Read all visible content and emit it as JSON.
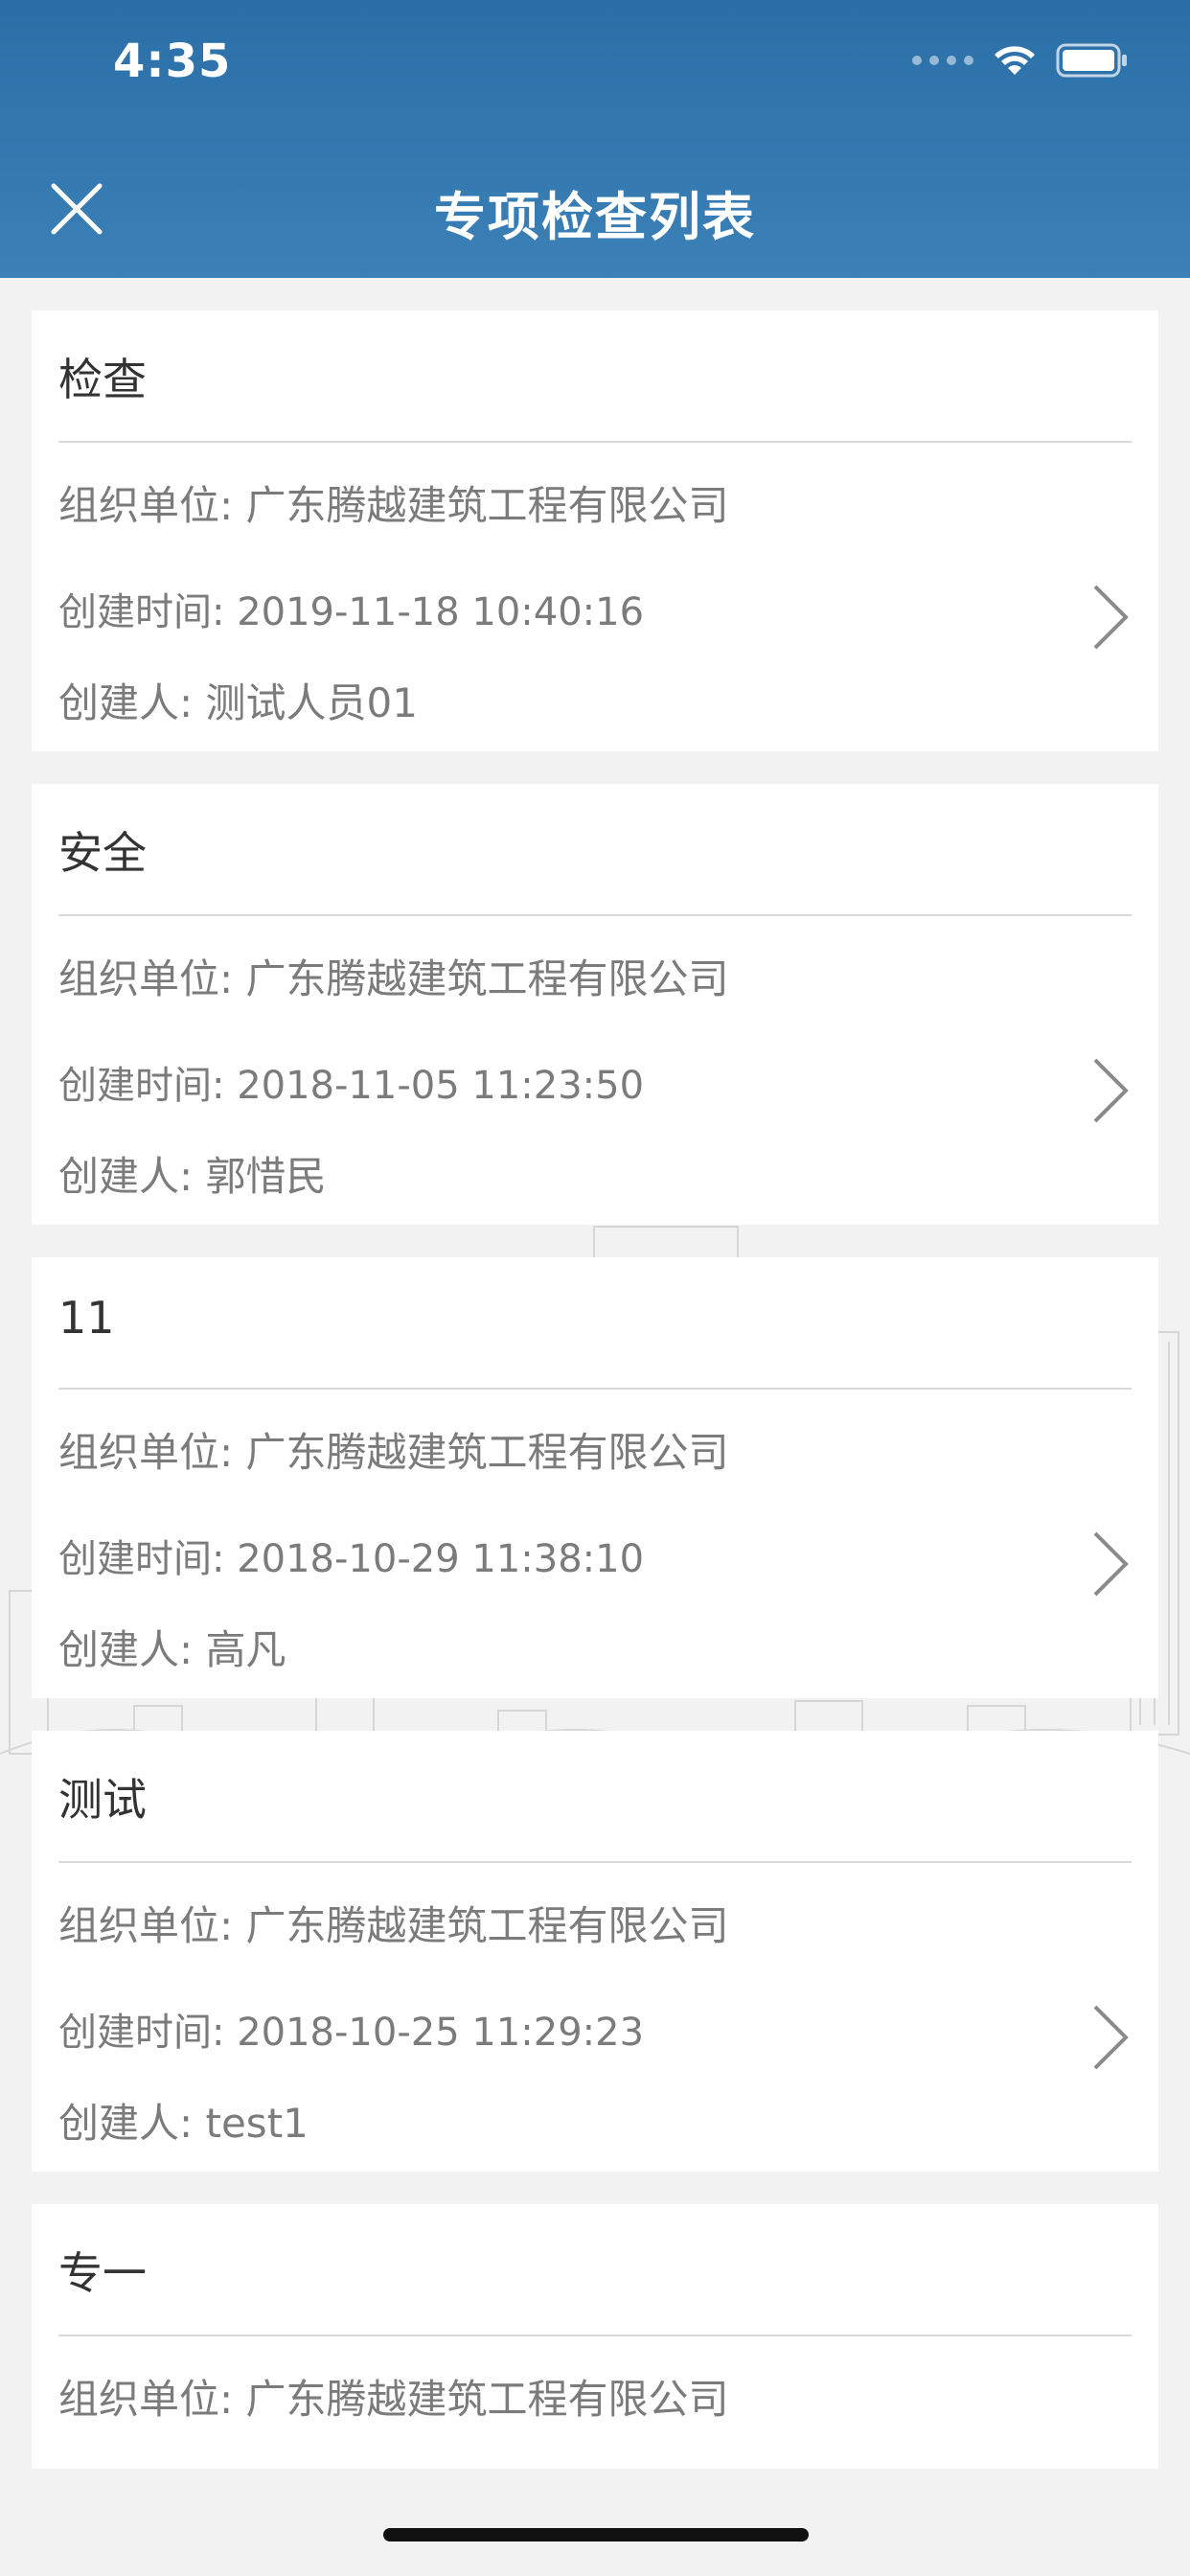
{
  "status_bar": {
    "time": "4:35"
  },
  "nav": {
    "title": "专项检查列表",
    "close_icon": "close-icon"
  },
  "list": [
    {
      "title": "检查",
      "org": "组织单位: 广东腾越建筑工程有限公司",
      "created_time": "创建时间: 2019-11-18 10:40:16",
      "creator": "创建人: 测试人员01"
    },
    {
      "title": "安全",
      "org": "组织单位: 广东腾越建筑工程有限公司",
      "created_time": "创建时间: 2018-11-05 11:23:50",
      "creator": "创建人: 郭惜民"
    },
    {
      "title": "11",
      "org": "组织单位: 广东腾越建筑工程有限公司",
      "created_time": "创建时间: 2018-10-29 11:38:10",
      "creator": "创建人: 高凡"
    },
    {
      "title": "测试",
      "org": "组织单位: 广东腾越建筑工程有限公司",
      "created_time": "创建时间: 2018-10-25 11:29:23",
      "creator": "创建人: test1"
    },
    {
      "title": "专一",
      "org": "组织单位: 广东腾越建筑工程有限公司"
    }
  ],
  "colors": {
    "header": "#2a6fa7",
    "card_bg": "#ffffff",
    "page_bg": "#f2f2f2"
  }
}
